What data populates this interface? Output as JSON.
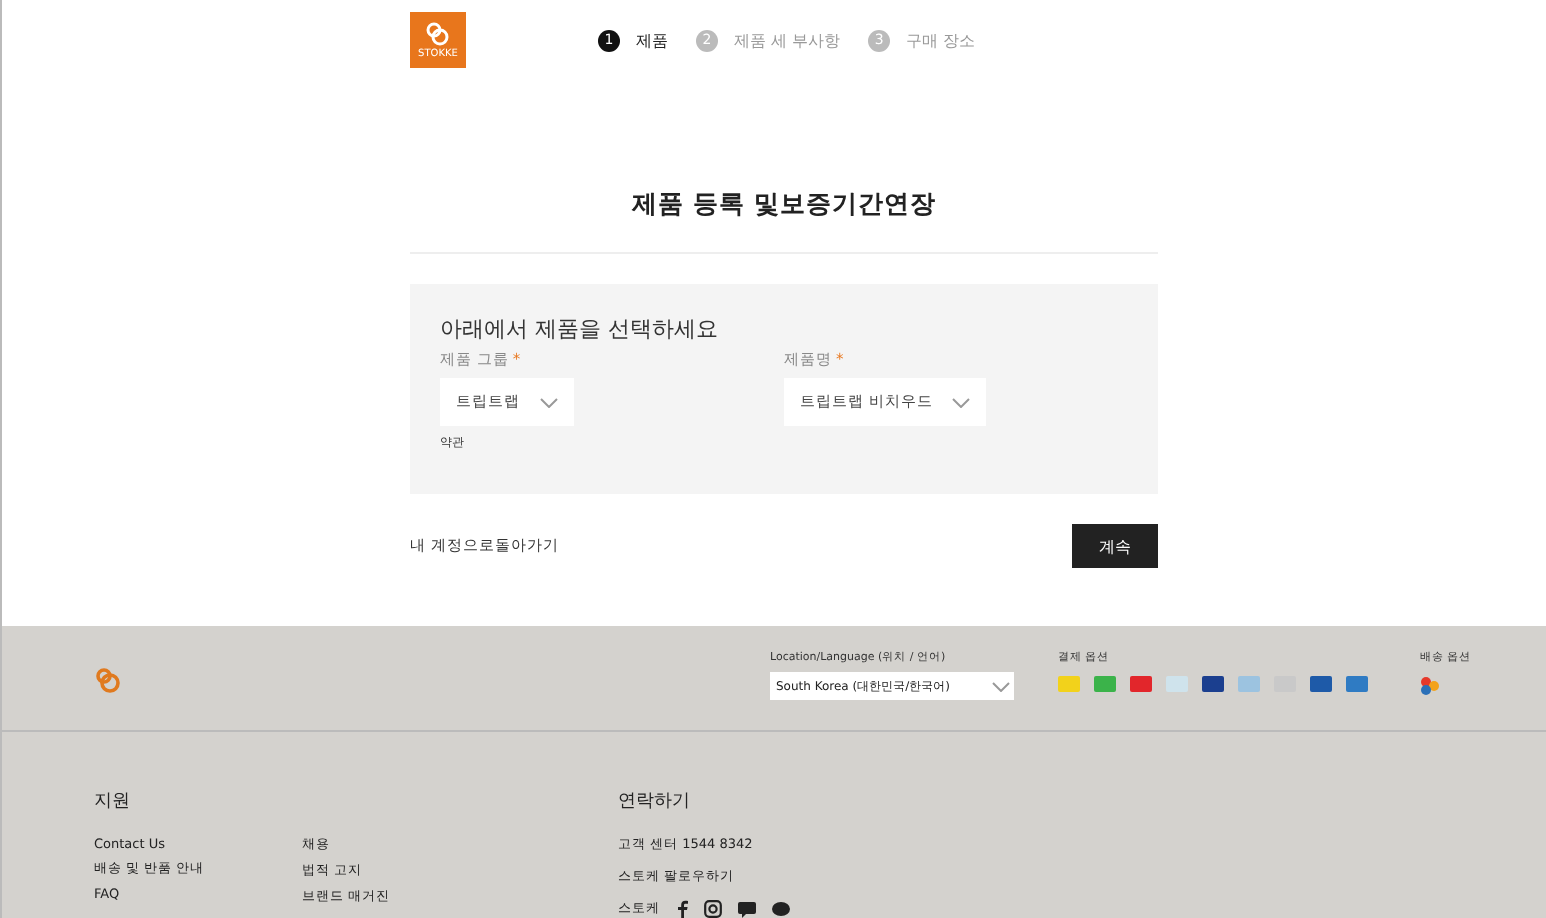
{
  "header": {
    "logo_text": "STOKKE",
    "steps": [
      {
        "number": "1",
        "label": "제품",
        "selected": true
      },
      {
        "number": "2",
        "label": "제품 세 부사항",
        "selected": false
      },
      {
        "number": "3",
        "label": "구매 장소",
        "selected": false
      }
    ]
  },
  "page_title": "제품 등록 및보증기간연장",
  "form": {
    "heading": "아래에서 제품을 선택하세요",
    "fields": [
      {
        "label": "제품 그룹",
        "required_mark": "*",
        "value": "트립트랩",
        "hint": "약관"
      },
      {
        "label": "제품명",
        "required_mark": "*",
        "value": "트립트랩 비치우드"
      }
    ]
  },
  "back_link": "내 계정으로돌아가기",
  "continue_button": "계속",
  "footer": {
    "location_label": "Location/Language (위치 / 언어)",
    "location_value": "South Korea (대한민국/한국어)",
    "payment_label": "결제 옵션",
    "payment_methods": [
      {
        "color": "#f2d21b"
      },
      {
        "color": "#3bb34a"
      },
      {
        "color": "#e2262b"
      },
      {
        "color": "#cfe3ec"
      },
      {
        "color": "#1b3f8f"
      },
      {
        "color": "#9cc3e0"
      },
      {
        "color": "#c9c9c9"
      },
      {
        "color": "#1e5aa8"
      },
      {
        "color": "#2f7bc3"
      }
    ],
    "shipping_label": "배송 옵션",
    "support_title": "지원",
    "support_col_1": [
      "Contact Us",
      "배송 및 반품 안내",
      "FAQ"
    ],
    "support_col_2": [
      "채용",
      "법적 고지",
      "브랜드 매거진"
    ],
    "contact_title": "연락하기",
    "contact_lines": [
      "고객 센터 1544 8342",
      "스토케 팔로우하기"
    ],
    "social_label": "스토케"
  }
}
